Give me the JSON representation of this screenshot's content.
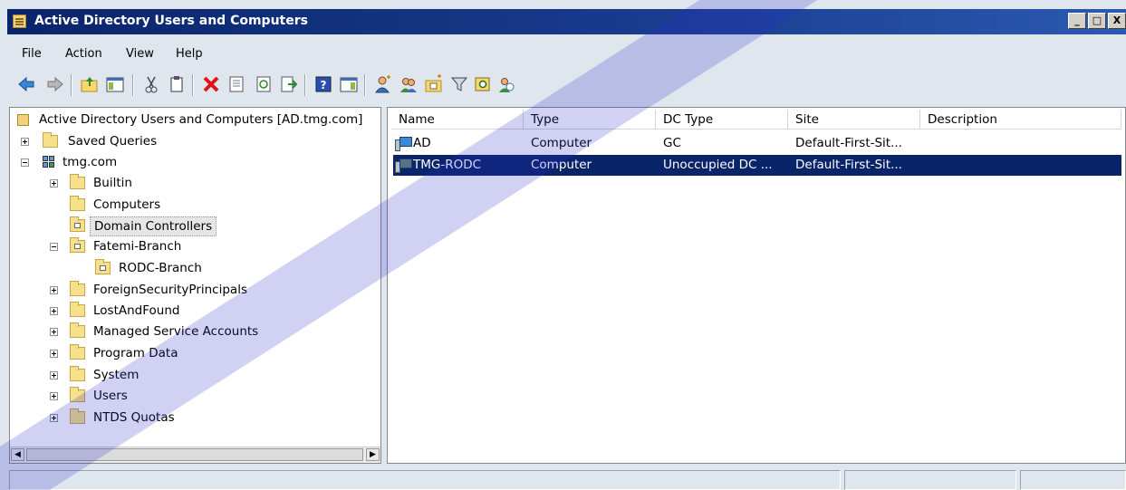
{
  "window": {
    "title": "Active Directory Users and Computers",
    "buttons": {
      "minimize": "_",
      "maximize": "□",
      "close": "X"
    }
  },
  "menu": [
    "File",
    "Action",
    "View",
    "Help"
  ],
  "toolbar_icons": [
    "back-icon",
    "forward-icon",
    "up-folder-icon",
    "show-console-tree-icon",
    "cut-icon",
    "copy-icon",
    "delete-icon",
    "properties-icon",
    "refresh-icon",
    "export-list-icon",
    "help-icon",
    "show-action-pane-icon",
    "new-user-icon",
    "new-group-icon",
    "new-ou-icon",
    "filter-icon",
    "find-icon",
    "add-to-group-icon"
  ],
  "tree": {
    "root": "Active Directory Users and Computers [AD.tmg.com]",
    "items": [
      {
        "label": "Saved Queries",
        "level": 1,
        "expander": "plus",
        "icon": "folder-icon"
      },
      {
        "label": "tmg.com",
        "level": 1,
        "expander": "minus",
        "icon": "domain-icon"
      },
      {
        "label": "Builtin",
        "level": 2,
        "expander": "plus",
        "icon": "folder-icon"
      },
      {
        "label": "Computers",
        "level": 2,
        "expander": "none",
        "icon": "folder-icon"
      },
      {
        "label": "Domain Controllers",
        "level": 2,
        "expander": "none",
        "icon": "ou-icon",
        "selected": true
      },
      {
        "label": "Fatemi-Branch",
        "level": 2,
        "expander": "minus",
        "icon": "ou-icon"
      },
      {
        "label": "RODC-Branch",
        "level": 3,
        "expander": "none",
        "icon": "ou-icon"
      },
      {
        "label": "ForeignSecurityPrincipals",
        "level": 2,
        "expander": "plus",
        "icon": "folder-icon"
      },
      {
        "label": "LostAndFound",
        "level": 2,
        "expander": "plus",
        "icon": "folder-icon"
      },
      {
        "label": "Managed Service Accounts",
        "level": 2,
        "expander": "plus",
        "icon": "folder-icon"
      },
      {
        "label": "Program Data",
        "level": 2,
        "expander": "plus",
        "icon": "folder-icon"
      },
      {
        "label": "System",
        "level": 2,
        "expander": "plus",
        "icon": "folder-icon"
      },
      {
        "label": "Users",
        "level": 2,
        "expander": "plus",
        "icon": "folder-icon"
      },
      {
        "label": "NTDS Quotas",
        "level": 2,
        "expander": "plus",
        "icon": "folder-icon"
      }
    ]
  },
  "list": {
    "columns": [
      "Name",
      "Type",
      "DC Type",
      "Site",
      "Description"
    ],
    "rows": [
      {
        "name": "AD",
        "type": "Computer",
        "dc_type": "GC",
        "site": "Default-First-Sit...",
        "description": "",
        "selected": false
      },
      {
        "name": "TMG-RODC",
        "type": "Computer",
        "dc_type": "Unoccupied DC ...",
        "site": "Default-First-Sit...",
        "description": "",
        "selected": true
      }
    ]
  },
  "colors": {
    "title_bar": "#0a246a",
    "selection": "#0a246a",
    "background": "#dfe6ee",
    "watermark": "#2b2fc8"
  }
}
